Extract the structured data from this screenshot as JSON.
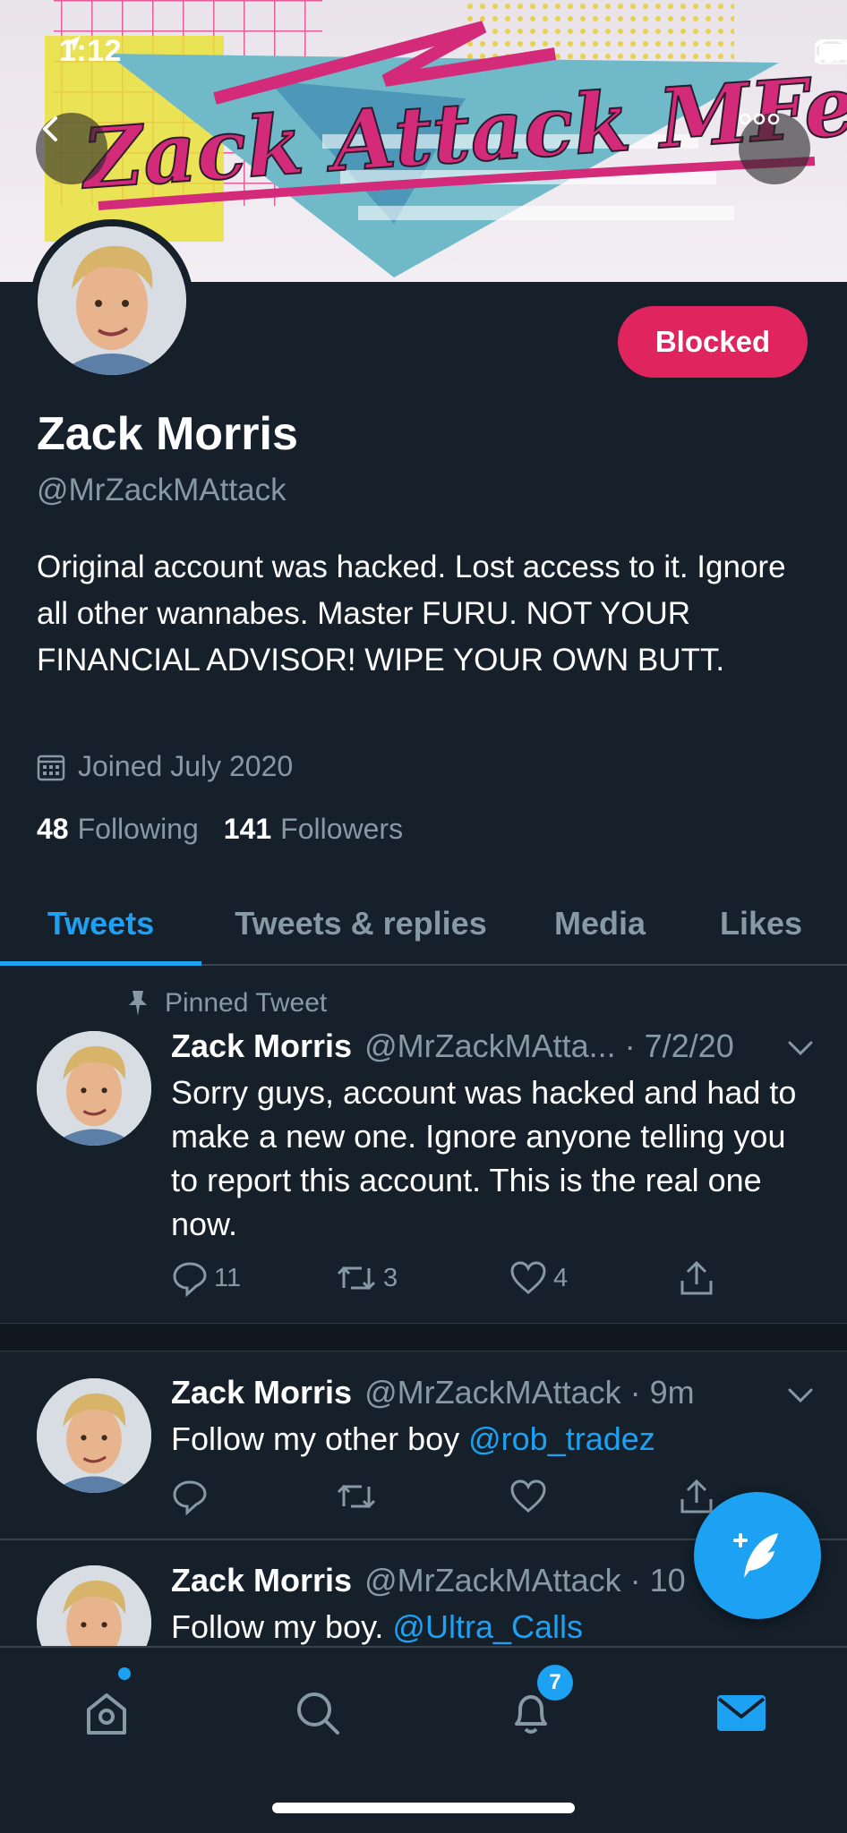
{
  "status_bar": {
    "time": "1:12"
  },
  "banner": {
    "text": "Zack Attack MFers!"
  },
  "profile": {
    "name": "Zack Morris",
    "handle": "@MrZackMAttack",
    "blocked_label": "Blocked",
    "bio": "Original account was hacked. Lost access to it. Ignore all other wannabes. Master FURU. NOT YOUR FINANCIAL ADVISOR! WIPE YOUR OWN BUTT.",
    "joined": "Joined July 2020",
    "following_count": "48",
    "following_label": "Following",
    "followers_count": "141",
    "followers_label": "Followers"
  },
  "tabs": [
    {
      "label": "Tweets",
      "active": true
    },
    {
      "label": "Tweets & replies"
    },
    {
      "label": "Media"
    },
    {
      "label": "Likes"
    }
  ],
  "tweets": [
    {
      "pinned_label": "Pinned Tweet",
      "name": "Zack Morris",
      "handle_time": "@MrZackMAtta... · 7/2/20",
      "text": "Sorry guys, account was hacked and had to make a new one. Ignore anyone telling you to report this account. This is the real one now.",
      "replies": "11",
      "retweets": "3",
      "likes": "4"
    },
    {
      "name": "Zack Morris",
      "handle_time": "@MrZackMAttack · 9m",
      "text": "Follow my other boy ",
      "mention": "@rob_tradez"
    },
    {
      "name": "Zack Morris",
      "handle_time": "@MrZackMAttack · 10",
      "text": "Follow my boy. ",
      "mention": "@Ultra_Calls"
    }
  ],
  "bottom_nav": {
    "notifications_badge": "7"
  },
  "colors": {
    "background": "#15202b",
    "accent": "#1da1f2",
    "blocked": "#e0245e",
    "muted": "#8899a6"
  }
}
